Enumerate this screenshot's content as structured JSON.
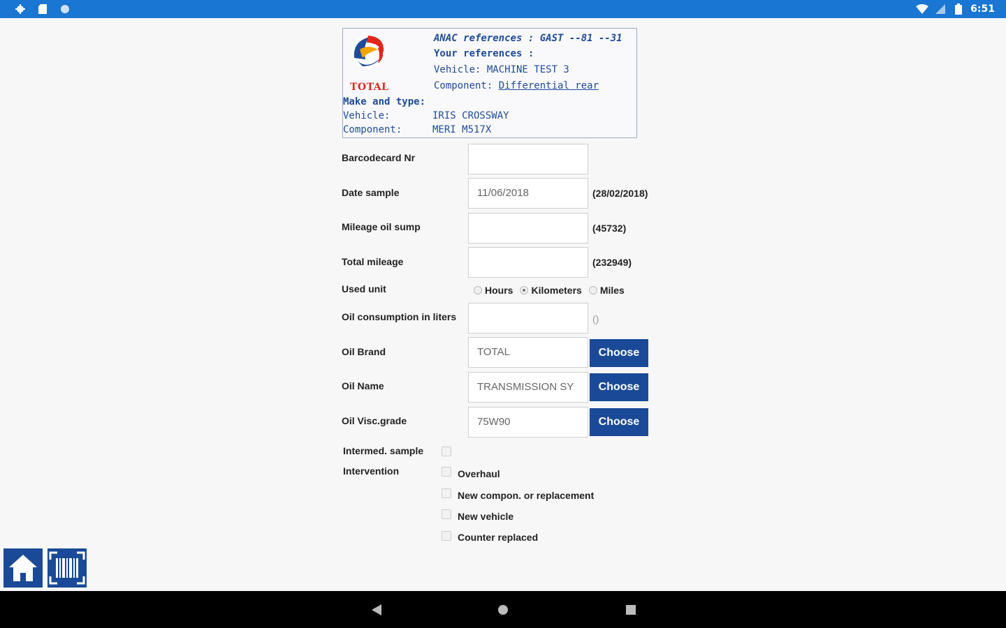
{
  "status_bar": {
    "time": "6:51",
    "left_icons": [
      "gear-icon",
      "sd-card-icon",
      "circle-icon"
    ],
    "right_icons": [
      "wifi-icon",
      "signal-icon",
      "battery-icon"
    ],
    "background": "#1976d2"
  },
  "header": {
    "logo_text": "TOTAL",
    "anac_refs": "ANAC references : GAST --81 --31",
    "your_refs": "Your references :",
    "vehicle_ref": "Vehicle: MACHINE TEST 3",
    "component_ref_label": "Component:",
    "component_ref_link": "Differential rear",
    "make_type_title": "Make and type:",
    "vehicle_label": "Vehicle:",
    "vehicle_value": "IRIS CROSSWAY",
    "component_label": "Component:",
    "component_value": "MERI M517X"
  },
  "form": {
    "barcode": {
      "label": "Barcodecard Nr",
      "value": ""
    },
    "date_sample": {
      "label": "Date sample",
      "value": "11/06/2018",
      "hint": "(28/02/2018)"
    },
    "mileage_oil_sump": {
      "label": "Mileage oil sump",
      "value": "",
      "hint": "(45732)"
    },
    "total_mileage": {
      "label": "Total mileage",
      "value": "",
      "hint": "(232949)"
    },
    "used_unit": {
      "label": "Used unit",
      "options": [
        "Hours",
        "Kilometers",
        "Miles"
      ],
      "selected": "Kilometers"
    },
    "oil_consumption": {
      "label": "Oil consumption in liters",
      "value": "",
      "hint": "()"
    },
    "oil_brand": {
      "label": "Oil Brand",
      "value": "TOTAL",
      "button": "Choose"
    },
    "oil_name": {
      "label": "Oil Name",
      "value": "TRANSMISSION SY",
      "button": "Choose"
    },
    "oil_visc": {
      "label": "Oil Visc.grade",
      "value": "75W90",
      "button": "Choose"
    },
    "intermed_sample": {
      "label": "Intermed. sample",
      "checked": false
    },
    "intervention": {
      "label": "Intervention",
      "options": [
        "Overhaul",
        "New compon. or replacement",
        "New vehicle",
        "Counter replaced"
      ]
    }
  },
  "bottom_actions": [
    "home-icon",
    "barcode-icon"
  ],
  "colors": {
    "accent": "#1a4a97",
    "link": "#1e4b9a",
    "logo_red": "#e1261c"
  }
}
